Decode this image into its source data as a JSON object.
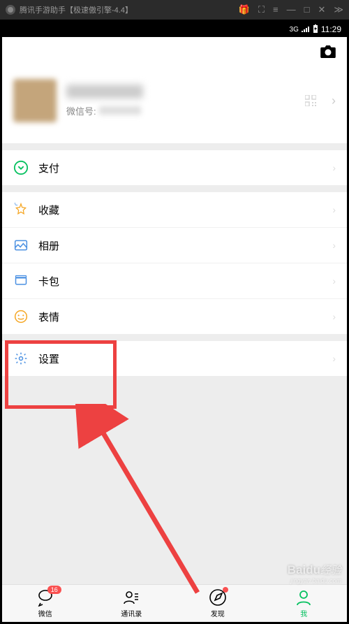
{
  "emulator": {
    "title": "腾讯手游助手【极速傲引擎-4.4】",
    "gift_icon": "🎁"
  },
  "statusbar": {
    "signal": "3G",
    "time": "11:29"
  },
  "profile": {
    "wechat_id_label": "微信号:"
  },
  "menu": {
    "pay": "支付",
    "favorites": "收藏",
    "album": "相册",
    "cards": "卡包",
    "sticker": "表情",
    "settings": "设置"
  },
  "tabs": {
    "wechat": {
      "label": "微信",
      "badge": "16"
    },
    "contacts": {
      "label": "通讯录"
    },
    "discover": {
      "label": "发现",
      "has_dot": true
    },
    "me": {
      "label": "我"
    }
  },
  "watermark": {
    "brand": "Baidu",
    "sub": "jingyan.baidu.com",
    "cn": "经验"
  },
  "colors": {
    "highlight": "#ed4141",
    "accent": "#07c160",
    "badge": "#fa5151"
  }
}
